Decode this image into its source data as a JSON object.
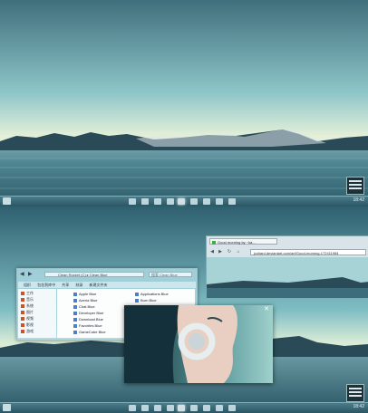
{
  "top_screen": {
    "tray_time": "18:42"
  },
  "bottom_screen": {
    "tray_time": "18:42"
  },
  "explorer": {
    "path": "Clean Rocket (C) ▸ Clean Blue",
    "search_placeholder": "搜索 Clean Blue",
    "toolbar": [
      "组织",
      "包含到库中",
      "共享",
      "刻录",
      "新建文件夹"
    ],
    "nav_items": [
      "工作",
      "音乐",
      "系统",
      "图片",
      "视频",
      "影视",
      "游戏"
    ],
    "files_col1": [
      "Apple Blue",
      "Azeria Blue",
      "Chat Blue",
      "Developer Blue",
      "Download Blue",
      "Favorites Blue",
      "GameCube Blue"
    ],
    "files_col2": [
      "Applications Blue",
      "Burn Blue",
      "Desktop Blue",
      "Documents Blue",
      "Dropbox Blue",
      "Fonts Blue",
      "Generic Blue"
    ]
  },
  "browser": {
    "tab_title": "Good morning by ~ka...",
    "url": "jcollard.deviantart.com/art/Good-morning-172411984"
  },
  "colors": {
    "taskbar": "#2b5563",
    "sky": "#9fd3d6",
    "water": "#3c7280"
  }
}
